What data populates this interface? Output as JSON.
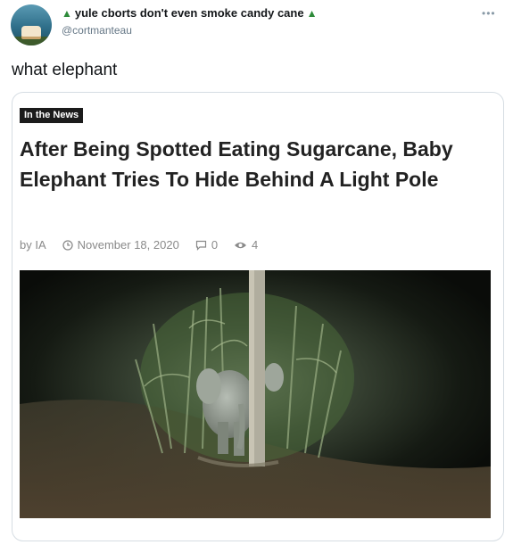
{
  "tweet": {
    "display_name": "yule cborts don't even smoke candy cane",
    "name_emoji_left": "christmas-tree-icon",
    "name_emoji_right": "christmas-tree-icon",
    "handle": "@cortmanteau",
    "more_icon": "more-dots-icon",
    "text": "what elephant"
  },
  "article_card": {
    "badge": "In the News",
    "headline": "After Being Spotted Eating Sugarcane, Baby Elephant Tries To Hide Behind A Light Pole",
    "meta": {
      "author": "by IA",
      "date": "November 18, 2020",
      "comments": "0",
      "views": "4"
    },
    "image_icon": "baby-elephant-behind-pole-photo"
  },
  "colors": {
    "text_primary": "#14171a",
    "text_secondary": "#657786",
    "card_border": "#d6dde3",
    "badge_bg": "#1b1b1b",
    "meta_text": "#8a8a8a"
  }
}
